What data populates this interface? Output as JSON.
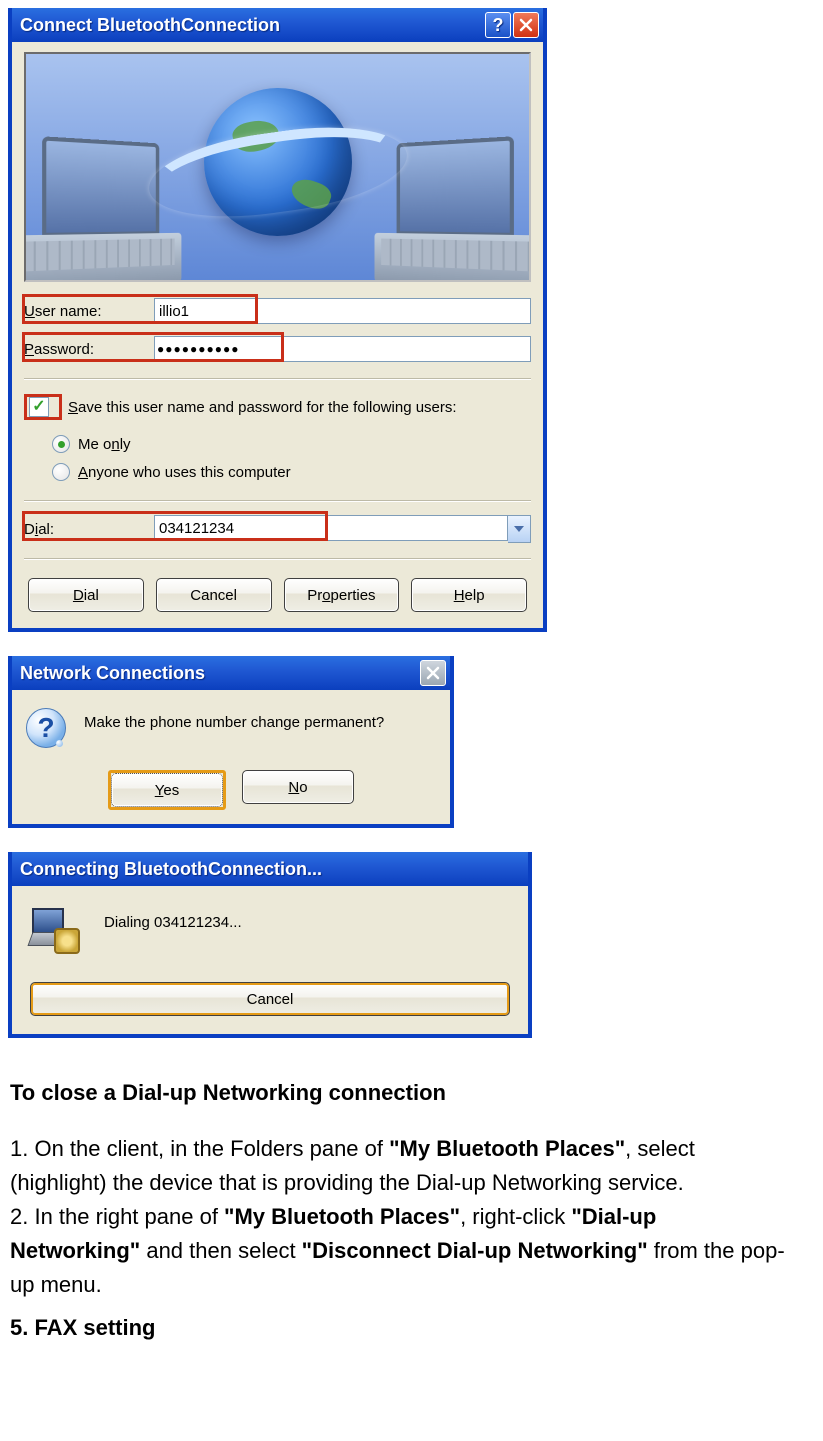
{
  "dialog1": {
    "title": "Connect BluetoothConnection",
    "username_label": "User name:",
    "username_value": "illio1",
    "password_label": "Password:",
    "password_mask": "●●●●●●●●●●",
    "save_label": "Save this user name and password for the following users:",
    "radio_me": "Me only",
    "radio_anyone": "Anyone who uses this computer",
    "dial_label": "Dial:",
    "dial_value": "034121234",
    "buttons": {
      "dial": "Dial",
      "cancel": "Cancel",
      "properties": "Properties",
      "help": "Help"
    }
  },
  "dialog2": {
    "title": "Network Connections",
    "message": "Make the phone number change permanent?",
    "yes": "Yes",
    "no": "No"
  },
  "dialog3": {
    "title": "Connecting BluetoothConnection...",
    "status": "Dialing 034121234...",
    "cancel": "Cancel"
  },
  "doc": {
    "heading": "To close a Dial-up Networking connection",
    "p1a": "1. On the client, in the Folders pane of ",
    "p1_bold1": "\"My Bluetooth Places\"",
    "p1b": ", select (highlight) the device that is providing the Dial-up Networking service.",
    "p2a": "2. In the right pane of ",
    "p2_bold1": "\"My Bluetooth Places\"",
    "p2b": ", right-click ",
    "p2_bold2": "\"Dial-up Networking\"",
    "p2c": " and then select ",
    "p2_bold3": "\"Disconnect Dial-up Networking\"",
    "p2d": " from the pop-up menu.",
    "sect": "5. FAX setting"
  }
}
